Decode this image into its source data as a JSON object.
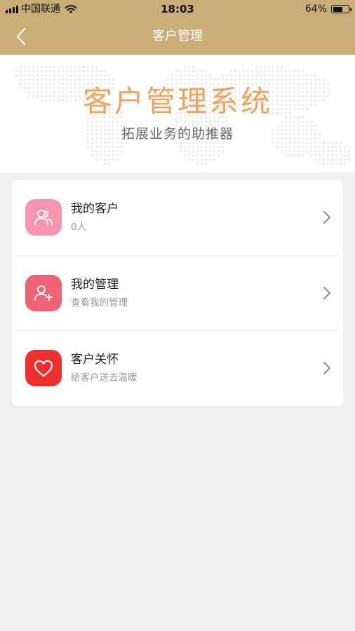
{
  "status_bar": {
    "carrier": "中国联通",
    "time": "18:03",
    "battery_percent": "64%",
    "battery_level": 0.64,
    "signal_icon": "cellular-signal-icon",
    "wifi_icon": "wifi-icon",
    "battery_icon": "battery-icon"
  },
  "nav": {
    "title": "客户管理",
    "back_icon": "chevron-left-icon"
  },
  "banner": {
    "title": "客户管理系统",
    "subtitle": "拓展业务的助推器",
    "background_icon": "world-map-icon"
  },
  "menu": {
    "items": [
      {
        "title": "我的客户",
        "subtitle": "0人",
        "icon": "users-icon",
        "icon_color": "#f595b1"
      },
      {
        "title": "我的管理",
        "subtitle": "查看我的管理",
        "icon": "add-user-icon",
        "icon_color": "#ee6275"
      },
      {
        "title": "客户关怀",
        "subtitle": "给客户送去温暖",
        "icon": "heart-icon",
        "icon_color": "#ef2e2e"
      }
    ],
    "chevron_icon": "chevron-right-icon"
  },
  "colors": {
    "header_bg": "#c9ae78",
    "banner_title": "#f0a35c",
    "page_bg": "#f0f0f0"
  }
}
